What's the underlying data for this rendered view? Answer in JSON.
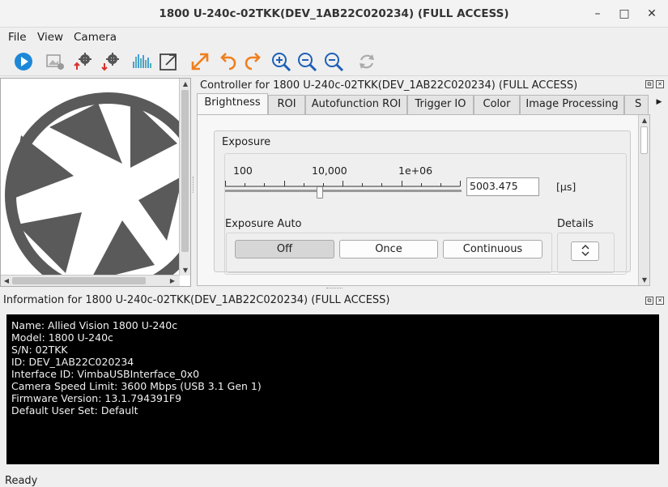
{
  "window": {
    "title": "1800 U-240c-02TKK(DEV_1AB22C020234) (FULL ACCESS)",
    "minimize": "–",
    "maximize": "□",
    "close": "✕"
  },
  "menu": {
    "items": [
      "File",
      "View",
      "Camera"
    ]
  },
  "toolbar": {
    "icons": [
      "play-icon",
      "image-settings-icon",
      "export-settings-icon",
      "import-settings-icon",
      "histogram-icon",
      "open-window-icon",
      "fit-to-window-icon",
      "rotate-left-icon",
      "rotate-right-icon",
      "zoom-in-icon",
      "zoom-reset-icon",
      "zoom-out-icon",
      "refresh-icon"
    ]
  },
  "controller": {
    "title": "Controller for 1800 U-240c-02TKK(DEV_1AB22C020234) (FULL ACCESS)",
    "tabs": [
      "Brightness",
      "ROI",
      "Autofunction ROI",
      "Trigger IO",
      "Color",
      "Image Processing",
      "S"
    ],
    "active_tab": "Brightness",
    "exposure": {
      "group_label": "Exposure",
      "ticks": [
        "100",
        "10,000",
        "1e+06"
      ],
      "value": "5003.475",
      "unit": "[µs]",
      "slider_position": 0.39
    },
    "exposure_auto": {
      "label": "Exposure Auto",
      "options": [
        "Off",
        "Once",
        "Continuous"
      ],
      "selected": "Off"
    },
    "details": {
      "label": "Details",
      "toggle_glyph": "⌃⌄"
    }
  },
  "information": {
    "title": "Information for 1800 U-240c-02TKK(DEV_1AB22C020234) (FULL ACCESS)",
    "lines": [
      "Name: Allied Vision 1800 U-240c",
      "Model: 1800 U-240c",
      "S/N: 02TKK",
      "ID: DEV_1AB22C020234",
      "Interface ID: VimbaUSBInterface_0x0",
      "Camera Speed Limit: 3600 Mbps (USB 3.1 Gen 1)",
      "Firmware Version: 13.1.794391F9",
      "Default User Set: Default"
    ]
  },
  "status": {
    "text": "Ready"
  },
  "colors": {
    "accent_blue": "#1e88d8",
    "accent_orange": "#f07f1c",
    "accent_red": "#d9302b",
    "aperture_gray": "#5a5a5a",
    "console_bg": "#000000"
  }
}
